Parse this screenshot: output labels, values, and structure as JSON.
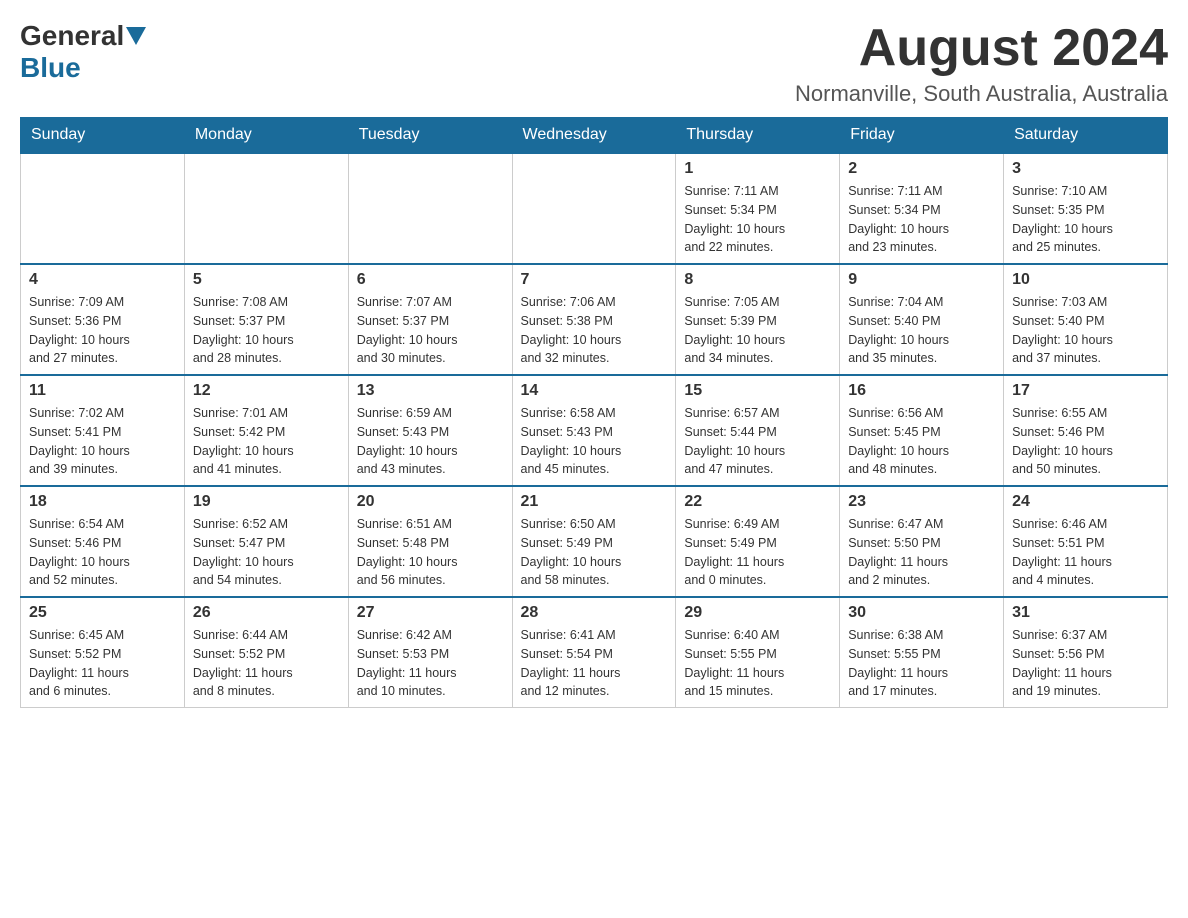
{
  "header": {
    "logo_general": "General",
    "logo_blue": "Blue",
    "month_title": "August 2024",
    "location": "Normanville, South Australia, Australia"
  },
  "weekdays": [
    "Sunday",
    "Monday",
    "Tuesday",
    "Wednesday",
    "Thursday",
    "Friday",
    "Saturday"
  ],
  "weeks": [
    [
      {
        "day": "",
        "info": ""
      },
      {
        "day": "",
        "info": ""
      },
      {
        "day": "",
        "info": ""
      },
      {
        "day": "",
        "info": ""
      },
      {
        "day": "1",
        "info": "Sunrise: 7:11 AM\nSunset: 5:34 PM\nDaylight: 10 hours\nand 22 minutes."
      },
      {
        "day": "2",
        "info": "Sunrise: 7:11 AM\nSunset: 5:34 PM\nDaylight: 10 hours\nand 23 minutes."
      },
      {
        "day": "3",
        "info": "Sunrise: 7:10 AM\nSunset: 5:35 PM\nDaylight: 10 hours\nand 25 minutes."
      }
    ],
    [
      {
        "day": "4",
        "info": "Sunrise: 7:09 AM\nSunset: 5:36 PM\nDaylight: 10 hours\nand 27 minutes."
      },
      {
        "day": "5",
        "info": "Sunrise: 7:08 AM\nSunset: 5:37 PM\nDaylight: 10 hours\nand 28 minutes."
      },
      {
        "day": "6",
        "info": "Sunrise: 7:07 AM\nSunset: 5:37 PM\nDaylight: 10 hours\nand 30 minutes."
      },
      {
        "day": "7",
        "info": "Sunrise: 7:06 AM\nSunset: 5:38 PM\nDaylight: 10 hours\nand 32 minutes."
      },
      {
        "day": "8",
        "info": "Sunrise: 7:05 AM\nSunset: 5:39 PM\nDaylight: 10 hours\nand 34 minutes."
      },
      {
        "day": "9",
        "info": "Sunrise: 7:04 AM\nSunset: 5:40 PM\nDaylight: 10 hours\nand 35 minutes."
      },
      {
        "day": "10",
        "info": "Sunrise: 7:03 AM\nSunset: 5:40 PM\nDaylight: 10 hours\nand 37 minutes."
      }
    ],
    [
      {
        "day": "11",
        "info": "Sunrise: 7:02 AM\nSunset: 5:41 PM\nDaylight: 10 hours\nand 39 minutes."
      },
      {
        "day": "12",
        "info": "Sunrise: 7:01 AM\nSunset: 5:42 PM\nDaylight: 10 hours\nand 41 minutes."
      },
      {
        "day": "13",
        "info": "Sunrise: 6:59 AM\nSunset: 5:43 PM\nDaylight: 10 hours\nand 43 minutes."
      },
      {
        "day": "14",
        "info": "Sunrise: 6:58 AM\nSunset: 5:43 PM\nDaylight: 10 hours\nand 45 minutes."
      },
      {
        "day": "15",
        "info": "Sunrise: 6:57 AM\nSunset: 5:44 PM\nDaylight: 10 hours\nand 47 minutes."
      },
      {
        "day": "16",
        "info": "Sunrise: 6:56 AM\nSunset: 5:45 PM\nDaylight: 10 hours\nand 48 minutes."
      },
      {
        "day": "17",
        "info": "Sunrise: 6:55 AM\nSunset: 5:46 PM\nDaylight: 10 hours\nand 50 minutes."
      }
    ],
    [
      {
        "day": "18",
        "info": "Sunrise: 6:54 AM\nSunset: 5:46 PM\nDaylight: 10 hours\nand 52 minutes."
      },
      {
        "day": "19",
        "info": "Sunrise: 6:52 AM\nSunset: 5:47 PM\nDaylight: 10 hours\nand 54 minutes."
      },
      {
        "day": "20",
        "info": "Sunrise: 6:51 AM\nSunset: 5:48 PM\nDaylight: 10 hours\nand 56 minutes."
      },
      {
        "day": "21",
        "info": "Sunrise: 6:50 AM\nSunset: 5:49 PM\nDaylight: 10 hours\nand 58 minutes."
      },
      {
        "day": "22",
        "info": "Sunrise: 6:49 AM\nSunset: 5:49 PM\nDaylight: 11 hours\nand 0 minutes."
      },
      {
        "day": "23",
        "info": "Sunrise: 6:47 AM\nSunset: 5:50 PM\nDaylight: 11 hours\nand 2 minutes."
      },
      {
        "day": "24",
        "info": "Sunrise: 6:46 AM\nSunset: 5:51 PM\nDaylight: 11 hours\nand 4 minutes."
      }
    ],
    [
      {
        "day": "25",
        "info": "Sunrise: 6:45 AM\nSunset: 5:52 PM\nDaylight: 11 hours\nand 6 minutes."
      },
      {
        "day": "26",
        "info": "Sunrise: 6:44 AM\nSunset: 5:52 PM\nDaylight: 11 hours\nand 8 minutes."
      },
      {
        "day": "27",
        "info": "Sunrise: 6:42 AM\nSunset: 5:53 PM\nDaylight: 11 hours\nand 10 minutes."
      },
      {
        "day": "28",
        "info": "Sunrise: 6:41 AM\nSunset: 5:54 PM\nDaylight: 11 hours\nand 12 minutes."
      },
      {
        "day": "29",
        "info": "Sunrise: 6:40 AM\nSunset: 5:55 PM\nDaylight: 11 hours\nand 15 minutes."
      },
      {
        "day": "30",
        "info": "Sunrise: 6:38 AM\nSunset: 5:55 PM\nDaylight: 11 hours\nand 17 minutes."
      },
      {
        "day": "31",
        "info": "Sunrise: 6:37 AM\nSunset: 5:56 PM\nDaylight: 11 hours\nand 19 minutes."
      }
    ]
  ]
}
